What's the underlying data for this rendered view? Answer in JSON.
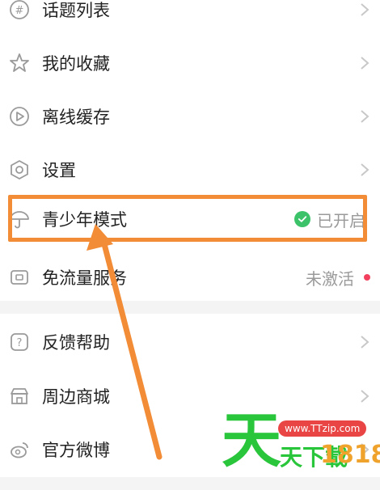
{
  "menu": {
    "items": [
      {
        "label": "话题列表",
        "icon": "hashtag-icon"
      },
      {
        "label": "我的收藏",
        "icon": "star-icon"
      },
      {
        "label": "离线缓存",
        "icon": "offline-cache-icon"
      },
      {
        "label": "设置",
        "icon": "settings-icon"
      },
      {
        "label": "青少年模式",
        "icon": "umbrella-icon",
        "status": "已开启"
      },
      {
        "label": "免流量服务",
        "icon": "data-free-icon",
        "status": "未激活"
      },
      {
        "label": "反馈帮助",
        "icon": "help-icon"
      },
      {
        "label": "周边商城",
        "icon": "store-icon"
      },
      {
        "label": "官方微博",
        "icon": "weibo-icon"
      }
    ]
  },
  "watermark": {
    "url": "www.TTzip.com",
    "big": "天",
    "sub": "天下載",
    "num": "1818"
  },
  "colors": {
    "highlight": "#f28c36",
    "check": "#3cc36a",
    "red_dot": "#f2405e",
    "watermark_green": "#29c53b"
  }
}
